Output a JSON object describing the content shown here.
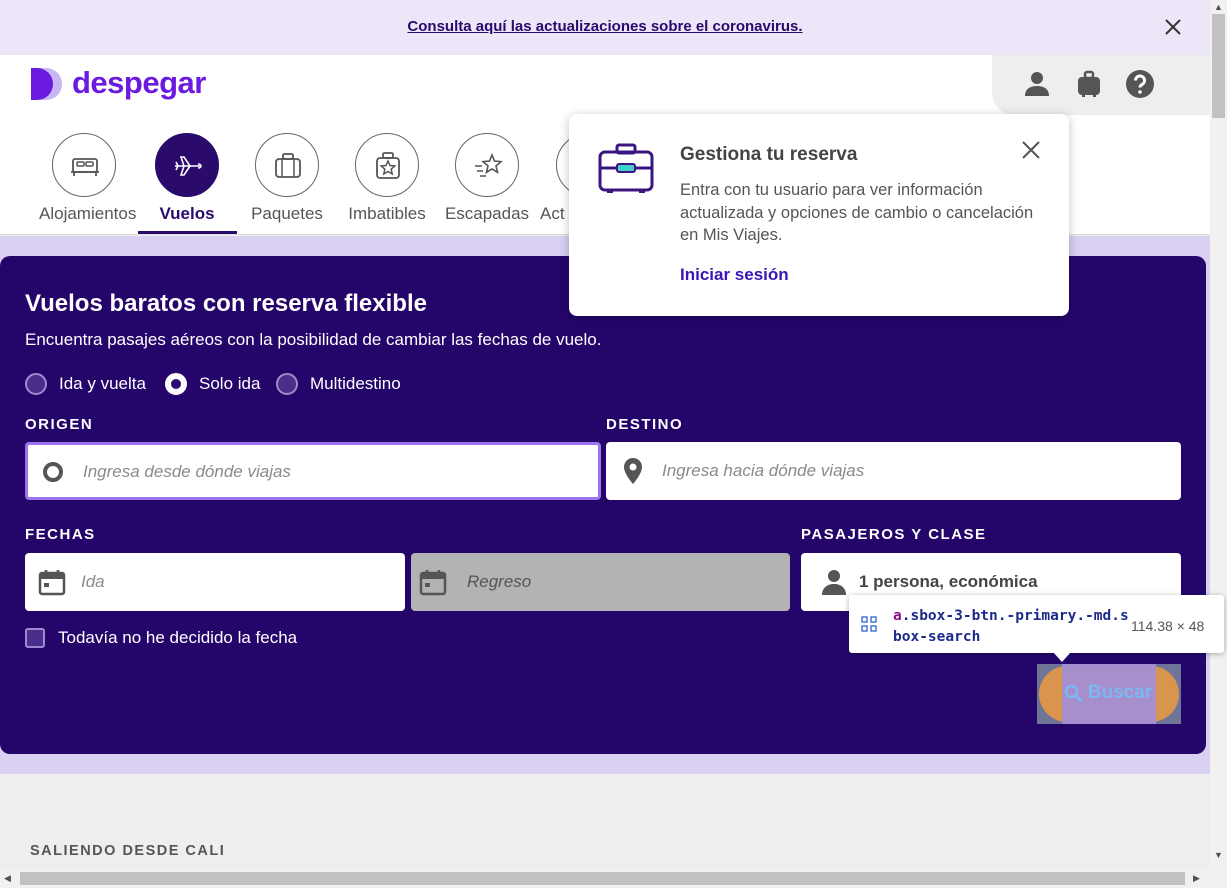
{
  "banner": {
    "link_text": "Consulta aquí las actualizaciones sobre el coronavirus."
  },
  "header": {
    "logo_text": "despegar",
    "products": [
      {
        "label": "Alojamientos",
        "icon": "bed-icon",
        "active": false
      },
      {
        "label": "Vuelos",
        "icon": "airplane-icon",
        "active": true
      },
      {
        "label": "Paquetes",
        "icon": "suitcase-icon",
        "active": false
      },
      {
        "label": "Imbatibles",
        "icon": "badge-star-icon",
        "active": false
      },
      {
        "label": "Escapadas",
        "icon": "shooting-star-icon",
        "active": false
      },
      {
        "label": "Act",
        "icon": "activities-icon",
        "active": false
      }
    ]
  },
  "popover": {
    "title": "Gestiona tu reserva",
    "description": "Entra con tu usuario para ver información actualizada y opciones de cambio o cancelación en Mis Viajes.",
    "link": "Iniciar sesión"
  },
  "search": {
    "title": "Vuelos baratos con reserva flexible",
    "subtitle": "Encuentra pasajes aéreos con la posibilidad de cambiar las fechas de vuelo.",
    "trip_types": [
      {
        "label": "Ida y vuelta",
        "selected": false
      },
      {
        "label": "Solo ida",
        "selected": true
      },
      {
        "label": "Multidestino",
        "selected": false
      }
    ],
    "origin_label": "ORIGEN",
    "origin_placeholder": "Ingresa desde dónde viajas",
    "destination_label": "DESTINO",
    "destination_placeholder": "Ingresa hacia dónde viajas",
    "dates_label": "FECHAS",
    "departure_placeholder": "Ida",
    "return_placeholder": "Regreso",
    "passengers_label": "PASAJEROS Y CLASE",
    "passengers_value": "1 persona, económica",
    "undecided_label": "Todavía no he decidido la fecha",
    "search_button": "Buscar"
  },
  "devtools_tooltip": {
    "tag": "a",
    "selector": ".sbox-3-btn.-primary.-md.sbox-search",
    "dimensions": "114.38 × 48"
  },
  "section": {
    "leaving_from": "SALIENDO DESDE CALI"
  },
  "colors": {
    "brand": "#6b1ae0",
    "card_bg": "#24066b",
    "band_bg": "#d9d0f2"
  }
}
